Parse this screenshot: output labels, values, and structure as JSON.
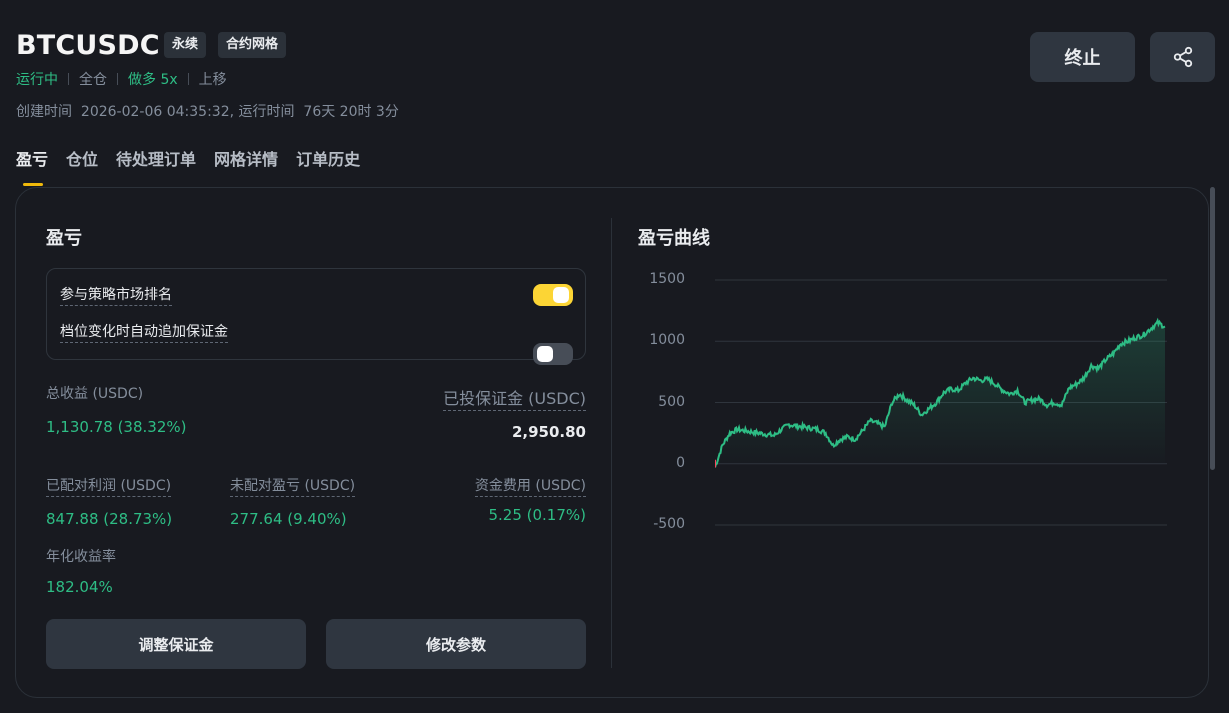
{
  "header": {
    "symbol": "BTCUSDC",
    "badge_perpetual": "永续",
    "badge_grid": "合约网格",
    "status": "运行中",
    "margin_mode": "全仓",
    "direction": "做多 5x",
    "trend": "上移",
    "created_label": "创建时间",
    "created_value": "2026-02-06 04:35:32, 运行时间",
    "runtime_value": "76天 20时 3分",
    "stop_label": "终止",
    "share_icon": "share-icon"
  },
  "tabs": [
    {
      "label": "盈亏"
    },
    {
      "label": "仓位"
    },
    {
      "label": "待处理订单"
    },
    {
      "label": "网格详情"
    },
    {
      "label": "订单历史"
    }
  ],
  "pnl": {
    "title": "盈亏",
    "toggle_rank_label": "参与策略市场排名",
    "toggle_rank_on": true,
    "toggle_margin_label": "档位变化时自动追加保证金",
    "toggle_margin_on": false,
    "total_profit_label": "总收益 (USDC)",
    "total_profit_value": "1,130.78 (38.32%)",
    "invested_label": "已投保证金 (USDC)",
    "invested_value": "2,950.80",
    "matched_label": "已配对利润 (USDC)",
    "matched_value": "847.88 (28.73%)",
    "unmatched_label": "未配对盈亏 (USDC)",
    "unmatched_value": "277.64 (9.40%)",
    "funding_label": "资金费用 (USDC)",
    "funding_value": "5.25 (0.17%)",
    "apr_label": "年化收益率",
    "apr_value": "182.04%",
    "adjust_margin_label": "调整保证金",
    "modify_params_label": "修改参数"
  },
  "chart_title": "盈亏曲线",
  "colors": {
    "accent": "#fcd535",
    "positive": "#2ebd85",
    "negative": "#f6465d"
  },
  "chart_data": {
    "type": "area",
    "title": "盈亏曲线",
    "ylim": [
      -500,
      1500
    ],
    "yticks": [
      1500,
      1000,
      500,
      0,
      -500
    ],
    "grid": true,
    "series": [
      {
        "values": [
          -30,
          150,
          250,
          280,
          270,
          260,
          250,
          240,
          230,
          280,
          320,
          310,
          300,
          290,
          280,
          250,
          150,
          200,
          220,
          200,
          270,
          350,
          330,
          300,
          500,
          570,
          520,
          480,
          400,
          450,
          500,
          580,
          610,
          600,
          660,
          700,
          680,
          690,
          650,
          600,
          570,
          600,
          500,
          520,
          530,
          480,
          500,
          480,
          620,
          650,
          700,
          800,
          780,
          850,
          900,
          980,
          1000,
          1030,
          1050,
          1100,
          1150,
          1120
        ]
      }
    ]
  }
}
